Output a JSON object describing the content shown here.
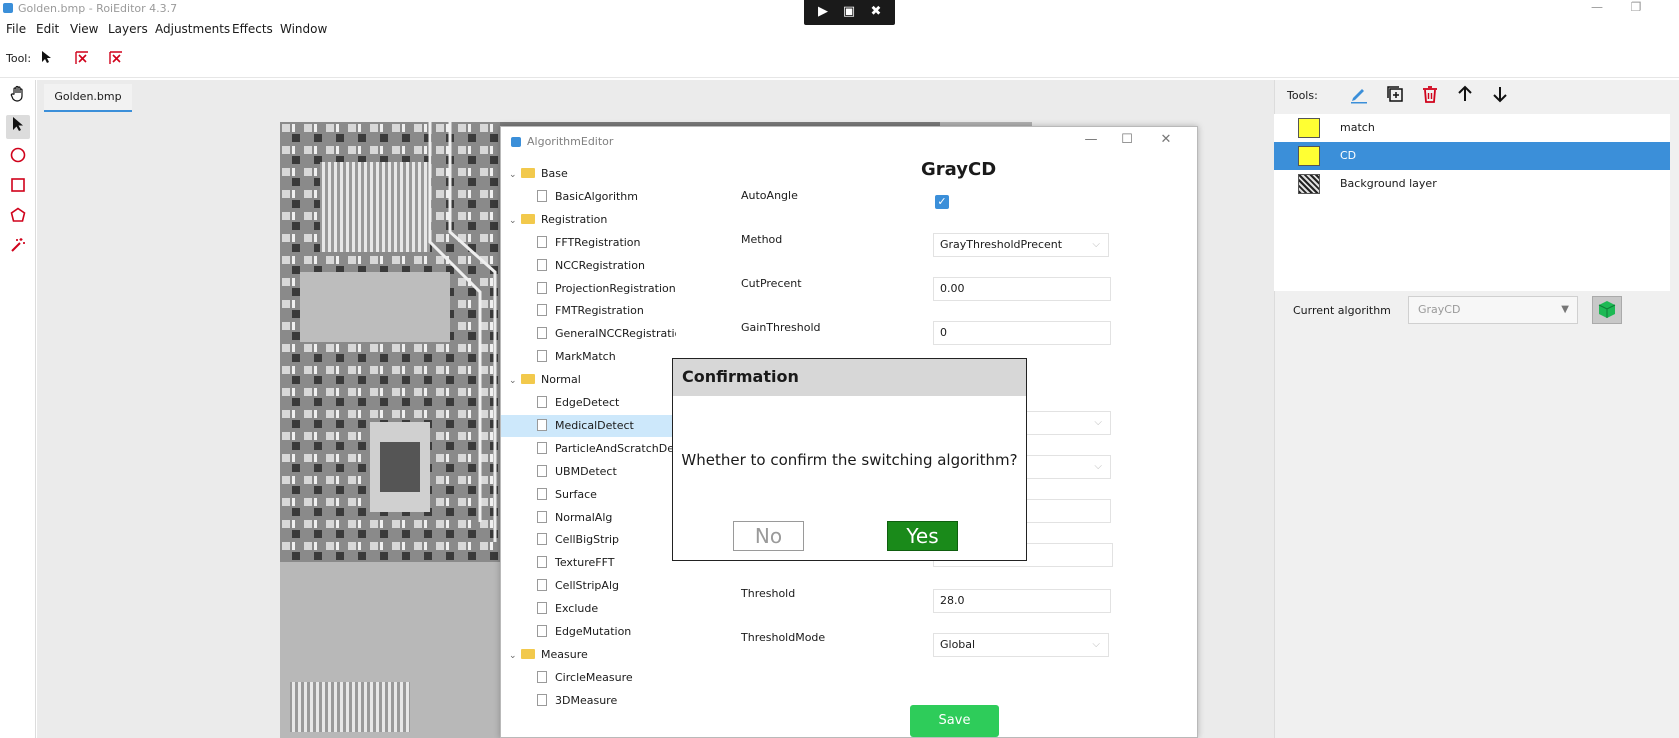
{
  "window": {
    "title": "Golden.bmp - RoiEditor 4.3.7",
    "minimize": "—",
    "restore": "❐"
  },
  "menu": [
    "File",
    "Edit",
    "View",
    "Layers",
    "Adjustments",
    "Effects",
    "Window"
  ],
  "toolrow": {
    "label": "Tool:"
  },
  "doc": {
    "tab": "Golden.bmp"
  },
  "rightpanel": {
    "tools_label": "Tools:",
    "layers": [
      {
        "name": "match",
        "color": "#ffff33"
      },
      {
        "name": "CD",
        "color": "#ffff33"
      },
      {
        "name": "Background layer",
        "color": ""
      }
    ],
    "current_algorithm_label": "Current algorithm",
    "current_algorithm_value": "GrayCD"
  },
  "algorithm_editor": {
    "title": "AlgorithmEditor",
    "heading": "GrayCD",
    "tree": [
      {
        "label": "Base",
        "type": "folder"
      },
      {
        "label": "BasicAlgorithm",
        "type": "file"
      },
      {
        "label": "Registration",
        "type": "folder"
      },
      {
        "label": "FFTRegistration",
        "type": "file"
      },
      {
        "label": "NCCRegistration",
        "type": "file"
      },
      {
        "label": "ProjectionRegistration",
        "type": "file"
      },
      {
        "label": "FMTRegistration",
        "type": "file"
      },
      {
        "label": "GeneralNCCRegistration",
        "type": "file"
      },
      {
        "label": "MarkMatch",
        "type": "file"
      },
      {
        "label": "Normal",
        "type": "folder"
      },
      {
        "label": "EdgeDetect",
        "type": "file"
      },
      {
        "label": "MedicalDetect",
        "type": "file",
        "selected": true
      },
      {
        "label": "ParticleAndScratchDete",
        "type": "file"
      },
      {
        "label": "UBMDetect",
        "type": "file"
      },
      {
        "label": "Surface",
        "type": "file"
      },
      {
        "label": "NormalAlg",
        "type": "file"
      },
      {
        "label": "CellBigStrip",
        "type": "file"
      },
      {
        "label": "TextureFFT",
        "type": "file"
      },
      {
        "label": "CellStripAlg",
        "type": "file"
      },
      {
        "label": "Exclude",
        "type": "file"
      },
      {
        "label": "EdgeMutation",
        "type": "file"
      },
      {
        "label": "Measure",
        "type": "folder"
      },
      {
        "label": "CircleMeasure",
        "type": "file"
      },
      {
        "label": "3DMeasure",
        "type": "file"
      }
    ],
    "props": {
      "autoangle_label": "AutoAngle",
      "autoangle_checked": true,
      "method_label": "Method",
      "method_value": "GrayThresholdPrecent",
      "cutprecent_label": "CutPrecent",
      "cutprecent_value": "0.00",
      "gainthreshold_label": "GainThreshold",
      "gainthreshold_value": "0",
      "threshold_label": "Threshold",
      "threshold_value": "28.0",
      "thresholdmode_label": "ThresholdMode",
      "thresholdmode_value": "Global"
    },
    "save_label": "Save"
  },
  "confirmation": {
    "title": "Confirmation",
    "message": "Whether to confirm the switching algorithm?",
    "no_label": "No",
    "yes_label": "Yes"
  },
  "colors": {
    "accent": "#3b8fd9",
    "yes_green": "#1a8a1a",
    "save_green": "#2ecc5a",
    "delete_red": "#d0021b",
    "tool_red": "#d0021b"
  }
}
